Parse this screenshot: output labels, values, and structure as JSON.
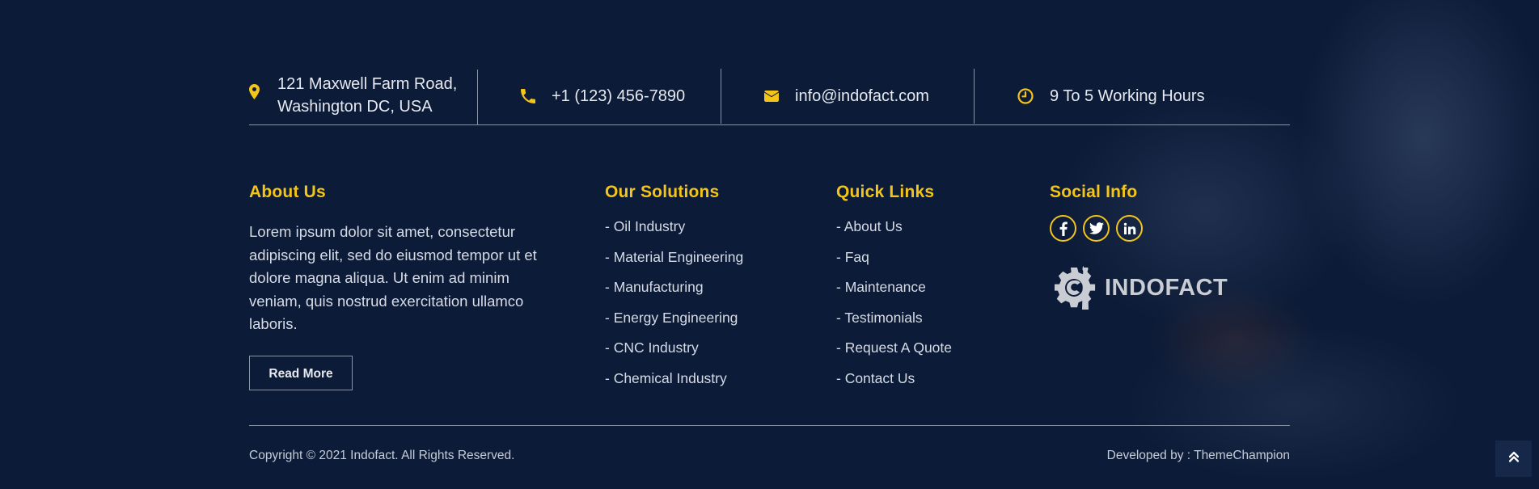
{
  "contact": {
    "address_line1": "121 Maxwell Farm Road,",
    "address_line2": "Washington DC, USA",
    "phone": "+1 (123) 456-7890",
    "email": "info@indofact.com",
    "hours": "9 To 5 Working Hours",
    "accent_color": "#f4c518"
  },
  "about": {
    "heading": "About Us",
    "text": "Lorem ipsum dolor sit amet, consectetur adipiscing elit, sed do eiusmod tempor ut et dolore magna aliqua. Ut enim ad minim veniam, quis nostrud exercitation ullamco laboris.",
    "read_more": "Read More"
  },
  "solutions": {
    "heading": "Our Solutions",
    "items": [
      "- Oil Industry",
      "- Material Engineering",
      "- Manufacturing",
      "- Energy Engineering",
      "- CNC Industry",
      "- Chemical Industry"
    ]
  },
  "quick_links": {
    "heading": "Quick Links",
    "items": [
      "- About Us",
      "- Faq",
      "- Maintenance",
      "- Testimonials",
      "- Request A Quote",
      "- Contact Us"
    ]
  },
  "social": {
    "heading": "Social Info",
    "icons": [
      "facebook-icon",
      "twitter-icon",
      "linkedin-icon"
    ],
    "logo_text": "INDOFACT"
  },
  "footer": {
    "copyright": "Copyright © 2021 Indofact. All Rights Reserved.",
    "developed_by": "Developed by : ThemeChampion"
  }
}
